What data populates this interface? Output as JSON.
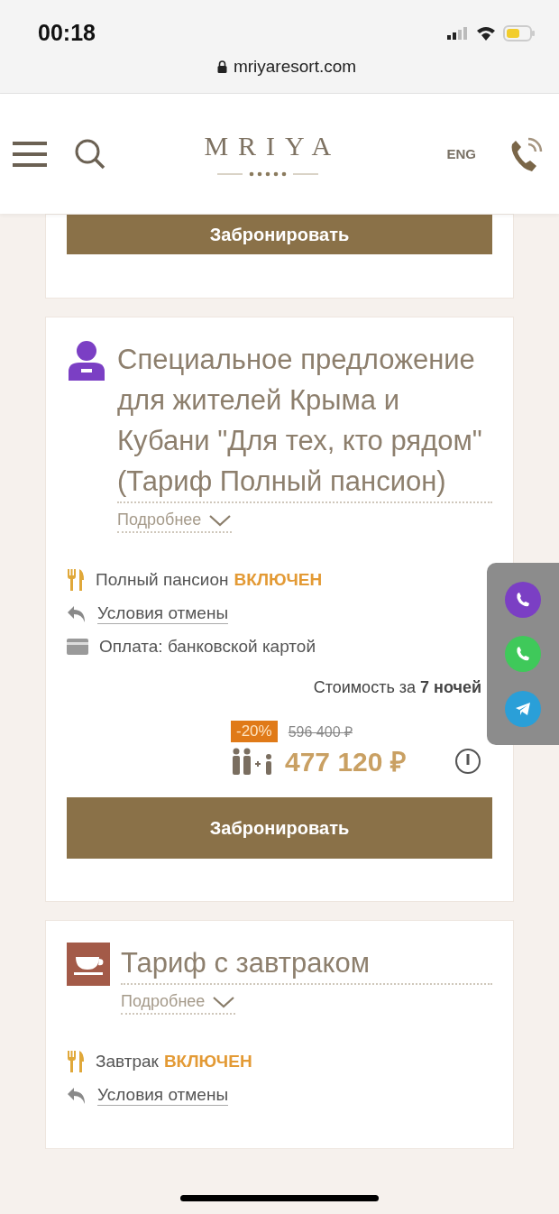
{
  "status_bar": {
    "time": "00:18",
    "url": "mriyaresort.com"
  },
  "header": {
    "logo": "MRIYA",
    "language": "ENG"
  },
  "top_card": {
    "button": "Забронировать"
  },
  "offers": [
    {
      "kind": "person",
      "title": "Специальное предложение для жителей Крыма и Кубани \"Для тех, кто рядом\" (Тариф Полный пансион)",
      "more": "Подробнее",
      "features": [
        {
          "kind": "meal",
          "text": "Полный пансион",
          "highlight": "ВКЛЮЧЕН"
        },
        {
          "kind": "cancel",
          "text": "Условия отмены"
        },
        {
          "kind": "payment",
          "text": "Оплата: банковской картой"
        }
      ],
      "price": {
        "label": "Стоимость за **7 ночей**",
        "discount": "-20%",
        "old": "596 400 ₽",
        "new": "477 120 ₽"
      },
      "button": "Забронировать"
    },
    {
      "kind": "cup",
      "title": "Тариф с завтраком",
      "more": "Подробнее",
      "features": [
        {
          "kind": "meal",
          "text": "Завтрак",
          "highlight": "ВКЛЮЧЕН"
        },
        {
          "kind": "cancel",
          "text": "Условия отмены"
        }
      ]
    }
  ],
  "messengers": [
    {
      "kind": "viber",
      "color": "#7b3fc4"
    },
    {
      "kind": "whatsapp",
      "color": "#3fc95a"
    },
    {
      "kind": "telegram",
      "color": "#2a9fd8"
    }
  ]
}
